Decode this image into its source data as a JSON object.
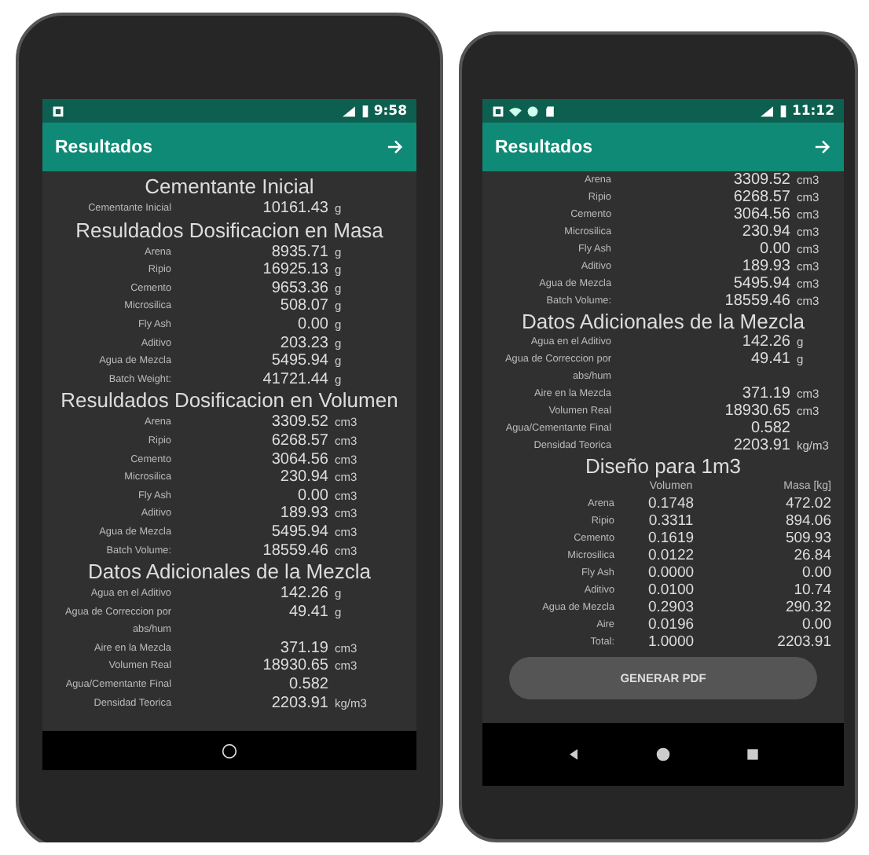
{
  "phones": [
    {
      "status_bar": {
        "notification_icons": [
          {
            "kind": "photo"
          }
        ],
        "time": "9:58"
      },
      "app_bar": {
        "title": "Resultados"
      },
      "content": [
        {
          "kind": "heading",
          "text": "Cementante Inicial"
        },
        {
          "kind": "row",
          "label": "Cementante Inicial",
          "value": "10161.43",
          "unit": "g"
        },
        {
          "kind": "heading",
          "text": "Resuldados Dosificacion en Masa"
        },
        {
          "kind": "row",
          "label": "Arena",
          "value": "8935.71",
          "unit": "g"
        },
        {
          "kind": "row",
          "label": "Ripio",
          "value": "16925.13",
          "unit": "g"
        },
        {
          "kind": "row",
          "label": "Cemento",
          "value": "9653.36",
          "unit": "g"
        },
        {
          "kind": "row",
          "label": "Microsilica",
          "value": "508.07",
          "unit": "g"
        },
        {
          "kind": "row",
          "label": "Fly Ash",
          "value": "0.00",
          "unit": "g"
        },
        {
          "kind": "row",
          "label": "Aditivo",
          "value": "203.23",
          "unit": "g"
        },
        {
          "kind": "row",
          "label": "Agua de Mezcla",
          "value": "5495.94",
          "unit": "g"
        },
        {
          "kind": "row",
          "label": "Batch Weight:",
          "value": "41721.44",
          "unit": "g"
        },
        {
          "kind": "heading",
          "text": "Resuldados Dosificacion en Volumen"
        },
        {
          "kind": "row",
          "label": "Arena",
          "value": "3309.52",
          "unit": "cm3"
        },
        {
          "kind": "row",
          "label": "Ripio",
          "value": "6268.57",
          "unit": "cm3"
        },
        {
          "kind": "row",
          "label": "Cemento",
          "value": "3064.56",
          "unit": "cm3"
        },
        {
          "kind": "row",
          "label": "Microsilica",
          "value": "230.94",
          "unit": "cm3"
        },
        {
          "kind": "row",
          "label": "Fly Ash",
          "value": "0.00",
          "unit": "cm3"
        },
        {
          "kind": "row",
          "label": "Aditivo",
          "value": "189.93",
          "unit": "cm3"
        },
        {
          "kind": "row",
          "label": "Agua de Mezcla",
          "value": "5495.94",
          "unit": "cm3"
        },
        {
          "kind": "row",
          "label": "Batch Volume:",
          "value": "18559.46",
          "unit": "cm3"
        },
        {
          "kind": "heading",
          "text": "Datos Adicionales de la Mezcla"
        },
        {
          "kind": "row",
          "label": "Agua en el Aditivo",
          "value": "142.26",
          "unit": "g"
        },
        {
          "kind": "row",
          "label": "Agua de Correccion por abs/hum",
          "value": "49.41",
          "unit": "g"
        },
        {
          "kind": "row",
          "label": "Aire en la Mezcla",
          "value": "371.19",
          "unit": "cm3"
        },
        {
          "kind": "row",
          "label": "Volumen Real",
          "value": "18930.65",
          "unit": "cm3"
        },
        {
          "kind": "row",
          "label": "Agua/Cementante Final",
          "value": "0.582"
        },
        {
          "kind": "row",
          "label": "Densidad Teorica",
          "value": "2203.91",
          "unit": "kg/m3"
        }
      ],
      "nav_bar": {
        "kind": "home_only"
      }
    },
    {
      "status_bar": {
        "notification_icons": [
          {
            "kind": "photo"
          },
          {
            "kind": "wifi"
          },
          {
            "kind": "circle"
          },
          {
            "kind": "sd"
          }
        ],
        "time": "11:12"
      },
      "app_bar": {
        "title": "Resultados"
      },
      "content": [
        {
          "kind": "row",
          "label": "Arena",
          "value": "3309.52",
          "unit": "cm3"
        },
        {
          "kind": "row",
          "label": "Ripio",
          "value": "6268.57",
          "unit": "cm3"
        },
        {
          "kind": "row",
          "label": "Cemento",
          "value": "3064.56",
          "unit": "cm3"
        },
        {
          "kind": "row",
          "label": "Microsilica",
          "value": "230.94",
          "unit": "cm3"
        },
        {
          "kind": "row",
          "label": "Fly Ash",
          "value": "0.00",
          "unit": "cm3"
        },
        {
          "kind": "row",
          "label": "Aditivo",
          "value": "189.93",
          "unit": "cm3"
        },
        {
          "kind": "row",
          "label": "Agua de Mezcla",
          "value": "5495.94",
          "unit": "cm3"
        },
        {
          "kind": "row",
          "label": "Batch Volume:",
          "value": "18559.46",
          "unit": "cm3"
        },
        {
          "kind": "heading",
          "text": "Datos Adicionales de la Mezcla"
        },
        {
          "kind": "row",
          "label": "Agua en el Aditivo",
          "value": "142.26",
          "unit": "g"
        },
        {
          "kind": "row",
          "label": "Agua de Correccion por abs/hum",
          "value": "49.41",
          "unit": "g"
        },
        {
          "kind": "row",
          "label": "Aire en la Mezcla",
          "value": "371.19",
          "unit": "cm3"
        },
        {
          "kind": "row",
          "label": "Volumen Real",
          "value": "18930.65",
          "unit": "cm3"
        },
        {
          "kind": "row",
          "label": "Agua/Cementante Final",
          "value": "0.582"
        },
        {
          "kind": "row",
          "label": "Densidad Teorica",
          "value": "2203.91",
          "unit": "kg/m3"
        },
        {
          "kind": "heading",
          "text": "Diseño para 1m3"
        },
        {
          "kind": "table_header",
          "columns": [
            "Volumen",
            "Masa [kg]"
          ]
        },
        {
          "kind": "table_row",
          "label": "Arena",
          "cells": [
            "0.1748",
            "472.02"
          ]
        },
        {
          "kind": "table_row",
          "label": "Ripio",
          "cells": [
            "0.3311",
            "894.06"
          ]
        },
        {
          "kind": "table_row",
          "label": "Cemento",
          "cells": [
            "0.1619",
            "509.93"
          ]
        },
        {
          "kind": "table_row",
          "label": "Microsilica",
          "cells": [
            "0.0122",
            "26.84"
          ]
        },
        {
          "kind": "table_row",
          "label": "Fly Ash",
          "cells": [
            "0.0000",
            "0.00"
          ]
        },
        {
          "kind": "table_row",
          "label": "Aditivo",
          "cells": [
            "0.0100",
            "10.74"
          ]
        },
        {
          "kind": "table_row",
          "label": "Agua de Mezcla",
          "cells": [
            "0.2903",
            "290.32"
          ]
        },
        {
          "kind": "table_row",
          "label": "Aire",
          "cells": [
            "0.0196",
            "0.00"
          ]
        },
        {
          "kind": "table_row",
          "label": "Total:",
          "cells": [
            "1.0000",
            "2203.91"
          ]
        },
        {
          "kind": "button",
          "label": "GENERAR PDF"
        }
      ],
      "nav_bar": {
        "kind": "three_buttons"
      }
    }
  ]
}
